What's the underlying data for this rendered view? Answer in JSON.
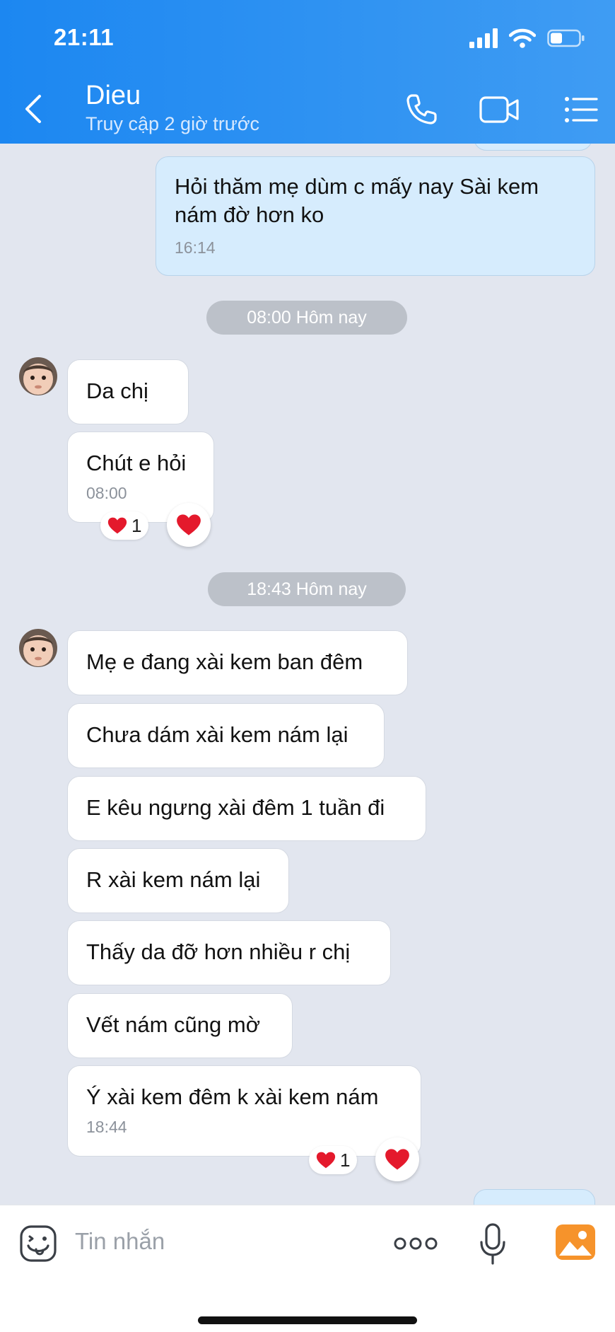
{
  "status_bar": {
    "time": "21:11"
  },
  "header": {
    "contact_name": "Dieu",
    "contact_status": "Truy cập 2 giờ trước",
    "icons": [
      "back-icon",
      "phone-icon",
      "video-icon",
      "menu-list-icon"
    ]
  },
  "messages": {
    "m1": {
      "text": "Hỏi thăm mẹ dùm c mấy nay Sài kem nám đờ hơn ko",
      "time": "16:14"
    },
    "d1": "08:00 Hôm nay",
    "m2": {
      "text": "Da chị"
    },
    "m3": {
      "text": "Chút e hỏi",
      "time": "08:00",
      "reaction_count": "1"
    },
    "d2": "18:43 Hôm nay",
    "m4": {
      "text": "Mẹ e đang xài kem ban đêm"
    },
    "m5": {
      "text": "Chưa dám xài kem nám lại"
    },
    "m6": {
      "text": "E kêu ngưng xài đêm 1 tuần đi"
    },
    "m7": {
      "text": "R xài kem nám lại"
    },
    "m8": {
      "text": "Thấy da đỡ hơn nhiều r chị"
    },
    "m9": {
      "text": "Vết nám cũng mờ"
    },
    "m10": {
      "text": "Ý xài kem đêm k xài kem nám",
      "time": "18:44",
      "reaction_count": "1"
    }
  },
  "input": {
    "placeholder": "Tin nhắn",
    "icons": [
      "sticker-icon",
      "more-icon",
      "microphone-icon",
      "image-icon"
    ]
  },
  "colors": {
    "header_start": "#1c87f1",
    "header_end": "#3f9cf3",
    "chat_background": "#e2e6ef",
    "outgoing_bubble": "#d6ecfd",
    "incoming_bubble": "#ffffff",
    "reaction_heart": "#e4192c"
  }
}
